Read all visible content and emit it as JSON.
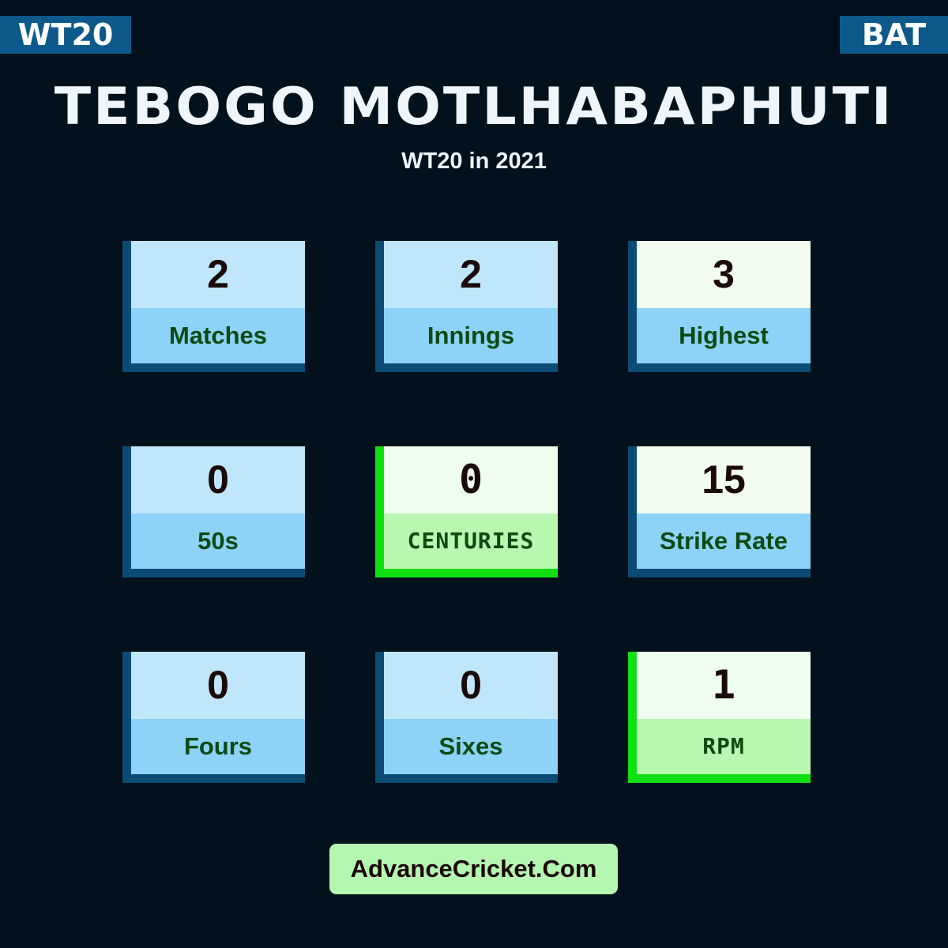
{
  "badges": {
    "format": "WT20",
    "role": "BAT"
  },
  "header": {
    "player_name": "TEBOGO MOTLHABAPHUTI",
    "subtitle": "WT20 in 2021"
  },
  "stats": [
    {
      "value": "2",
      "label": "Matches"
    },
    {
      "value": "2",
      "label": "Innings"
    },
    {
      "value": "3",
      "label": "Highest"
    },
    {
      "value": "0",
      "label": "50s"
    },
    {
      "value": "0",
      "label": "CENTURIES"
    },
    {
      "value": "15",
      "label": "Strike Rate"
    },
    {
      "value": "0",
      "label": "Fours"
    },
    {
      "value": "0",
      "label": "Sixes"
    },
    {
      "value": "1",
      "label": "RPM"
    }
  ],
  "footer": {
    "site": "AdvanceCricket.Com"
  },
  "colors": {
    "background": "#03111c",
    "badge": "#0d5a8a",
    "card_value": "#bfe6fb",
    "card_label": "#8dd2f7",
    "highlight_green": "#0ee012",
    "footer_bg": "#b5f7b0"
  }
}
